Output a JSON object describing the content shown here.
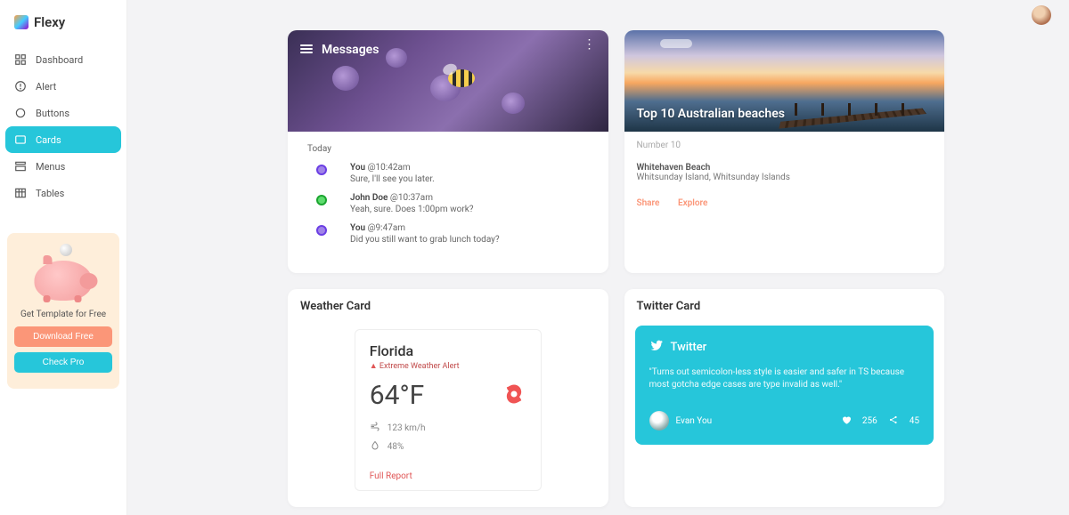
{
  "brand": {
    "name": "Flexy"
  },
  "sidebar": {
    "items": [
      {
        "label": "Dashboard",
        "icon": "dashboard-icon"
      },
      {
        "label": "Alert",
        "icon": "alert-icon"
      },
      {
        "label": "Buttons",
        "icon": "radio-icon"
      },
      {
        "label": "Cards",
        "icon": "cards-icon",
        "active": true
      },
      {
        "label": "Menus",
        "icon": "menus-icon"
      },
      {
        "label": "Tables",
        "icon": "tables-icon"
      }
    ]
  },
  "promo": {
    "title": "Get Template for Free",
    "download_label": "Download Free",
    "checkpro_label": "Check Pro"
  },
  "messages_card": {
    "header": "Messages",
    "section_label": "Today",
    "items": [
      {
        "sender": "You",
        "time": "@10:42am",
        "text": "Sure, I'll see you later.",
        "color": "purple"
      },
      {
        "sender": "John Doe",
        "time": "@10:37am",
        "text": "Yeah, sure. Does 1:00pm work?",
        "color": "green"
      },
      {
        "sender": "You",
        "time": "@9:47am",
        "text": "Did you still want to grab lunch today?",
        "color": "purple"
      }
    ]
  },
  "beaches_card": {
    "title": "Top 10 Australian beaches",
    "subtitle": "Number 10",
    "place": "Whitehaven Beach",
    "location": "Whitsunday Island, Whitsunday Islands",
    "share_label": "Share",
    "explore_label": "Explore"
  },
  "weather_card": {
    "card_title": "Weather Card",
    "city": "Florida",
    "alert": "Extreme Weather Alert",
    "temp": "64°F",
    "wind": "123 km/h",
    "humidity": "48%",
    "report_label": "Full Report"
  },
  "twitter_card": {
    "card_title": "Twitter Card",
    "brand": "Twitter",
    "quote": "\"Turns out semicolon-less style is easier and safer in TS because most gotcha edge cases are type invalid as well.\"",
    "user": "Evan You",
    "hearts": "256",
    "shares": "45"
  },
  "colors": {
    "accent_teal": "#26c6da",
    "accent_orange": "#fb9678",
    "danger": "#e05656"
  }
}
